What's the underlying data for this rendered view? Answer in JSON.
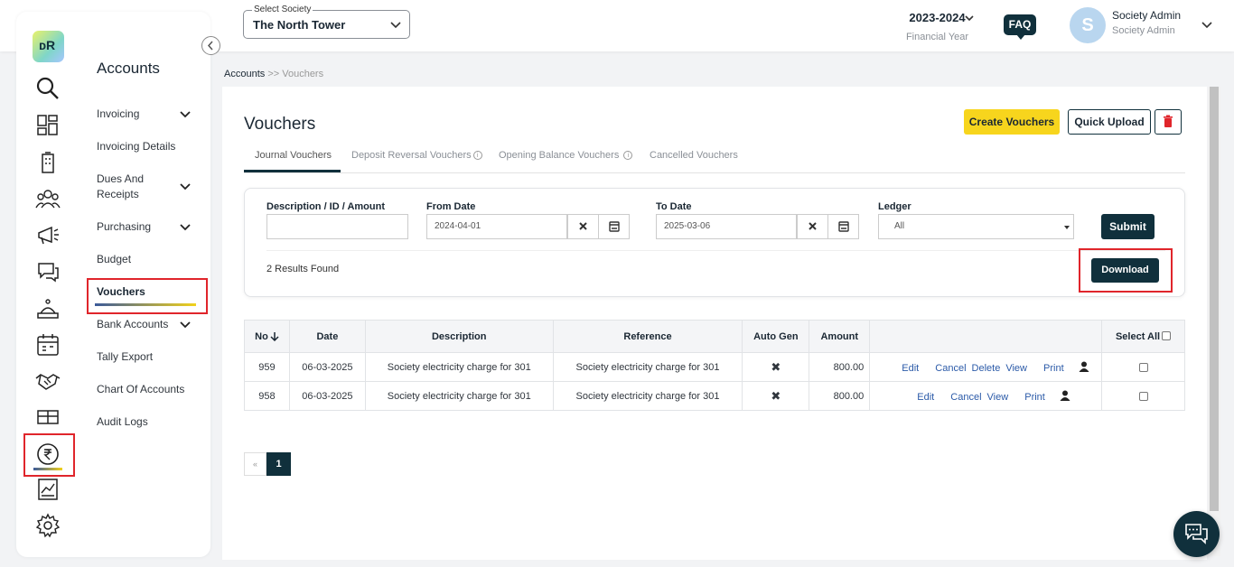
{
  "header": {
    "society_label": "Select Society",
    "society_value": "The North Tower",
    "financial_year": "2023-2024",
    "financial_year_label": "Financial Year",
    "faq": "FAQ",
    "avatar_initial": "S",
    "user_name": "Society Admin",
    "user_role": "Society Admin"
  },
  "sidebar": {
    "logo_text": "ᴅR",
    "title": "Accounts",
    "items": [
      {
        "label": "Invoicing",
        "has_chevron": true
      },
      {
        "label": "Invoicing Details",
        "has_chevron": false
      },
      {
        "label": "Dues And Receipts",
        "has_chevron": true
      },
      {
        "label": "Purchasing",
        "has_chevron": true
      },
      {
        "label": "Budget",
        "has_chevron": false
      },
      {
        "label": "Vouchers",
        "has_chevron": false,
        "active": true
      },
      {
        "label": "Bank Accounts",
        "has_chevron": true
      },
      {
        "label": "Tally Export",
        "has_chevron": false
      },
      {
        "label": "Chart Of Accounts",
        "has_chevron": false
      },
      {
        "label": "Audit Logs",
        "has_chevron": false
      }
    ],
    "nav_icons": [
      "search-icon",
      "dashboard-icon",
      "building-icon",
      "people-icon",
      "megaphone-icon",
      "chat-icon",
      "service-icon",
      "calendar-icon",
      "handshake-icon",
      "amenity-icon",
      "rupee-icon",
      "report-icon",
      "settings-icon"
    ]
  },
  "breadcrumb": {
    "root": "Accounts",
    "separator": ">>",
    "current": "Vouchers"
  },
  "page": {
    "title": "Vouchers",
    "create_button": "Create Vouchers",
    "quick_upload_button": "Quick Upload"
  },
  "tabs": [
    {
      "label": "Journal Vouchers",
      "active": true,
      "info": false
    },
    {
      "label": "Deposit Reversal Vouchers",
      "active": false,
      "info": true
    },
    {
      "label": "Opening Balance Vouchers",
      "active": false,
      "info": true
    },
    {
      "label": "Cancelled Vouchers",
      "active": false,
      "info": false
    }
  ],
  "filters": {
    "description_label": "Description / ID / Amount",
    "description_value": "",
    "from_label": "From Date",
    "from_value": "2024-04-01",
    "to_label": "To Date",
    "to_value": "2025-03-06",
    "ledger_label": "Ledger",
    "ledger_value": "All",
    "submit": "Submit",
    "results": "2 Results Found",
    "download": "Download"
  },
  "table": {
    "headers": [
      "No",
      "Date",
      "Description",
      "Reference",
      "Auto Gen",
      "Amount",
      "",
      "Select All"
    ],
    "rows": [
      {
        "no": "959",
        "date": "06-03-2025",
        "description": "Society electricity charge for 301",
        "reference": "Society electricity charge for 301",
        "auto_gen": "✖",
        "amount": "800.00",
        "actions": [
          "Edit",
          "Cancel",
          "Delete",
          "View",
          "Print"
        ]
      },
      {
        "no": "958",
        "date": "06-03-2025",
        "description": "Society electricity charge for 301",
        "reference": "Society electricity charge for 301",
        "auto_gen": "✖",
        "amount": "800.00",
        "actions": [
          "Edit",
          "Cancel",
          "View",
          "Print"
        ]
      }
    ]
  },
  "pagination": {
    "prev": "«",
    "current": "1"
  },
  "colors": {
    "primary": "#10303c",
    "accent": "#f7d51d",
    "highlight": "#e0252b",
    "link": "#2b5aa8"
  }
}
